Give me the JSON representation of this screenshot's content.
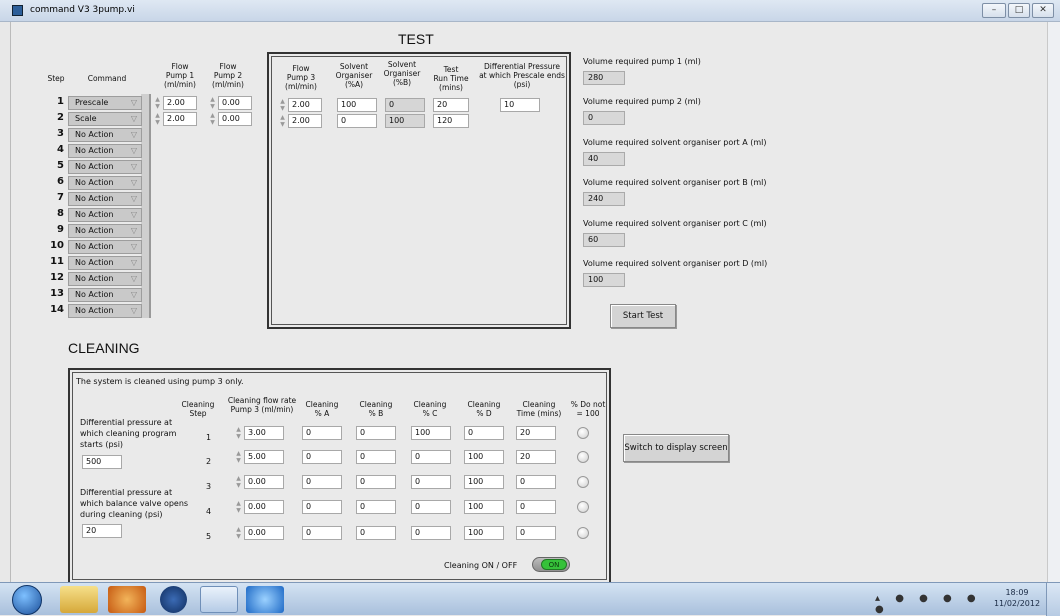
{
  "window": {
    "title": "command V3 3pump.vi",
    "controls": [
      "–",
      "□",
      "✕"
    ]
  },
  "test": {
    "title": "TEST",
    "headers": {
      "step": "Step",
      "command": "Command",
      "flow1": [
        "Flow",
        "Pump 1",
        "(ml/min)"
      ],
      "flow2": [
        "Flow",
        "Pump 2",
        "(ml/min)"
      ],
      "flow3": [
        "Flow",
        "Pump 3",
        "(ml/min)"
      ],
      "solA": [
        "Solvent",
        "Organiser",
        "(%A)"
      ],
      "solB": [
        "Solvent",
        "Organiser",
        "(%B)"
      ],
      "runtime": [
        "Test",
        "Run Time",
        "(mins)"
      ],
      "dp": [
        "Differential Pressure",
        "at which Prescale ends",
        "(psi)"
      ]
    },
    "steps": [
      "1",
      "2",
      "3",
      "4",
      "5",
      "6",
      "7",
      "8",
      "9",
      "10",
      "11",
      "12",
      "13",
      "14"
    ],
    "commands": [
      "Prescale",
      "Scale",
      "No Action",
      "No Action",
      "No Action",
      "No Action",
      "No Action",
      "No Action",
      "No Action",
      "No Action",
      "No Action",
      "No Action",
      "No Action",
      "No Action"
    ],
    "rows": [
      {
        "flow1": "2.00",
        "flow2": "0.00",
        "flow3": "2.00",
        "solA": "100",
        "solB": "0",
        "runtime": "20",
        "dp": "10"
      },
      {
        "flow1": "2.00",
        "flow2": "0.00",
        "flow3": "2.00",
        "solA": "0",
        "solB": "100",
        "runtime": "120"
      }
    ]
  },
  "volumes": [
    {
      "label": "Volume required pump 1 (ml)",
      "value": "280"
    },
    {
      "label": "Volume required pump 2 (ml)",
      "value": "0"
    },
    {
      "label": "Volume required solvent organiser port A (ml)",
      "value": "40"
    },
    {
      "label": "Volume required solvent organiser port B (ml)",
      "value": "240"
    },
    {
      "label": "Volume required solvent organiser port C (ml)",
      "value": "60"
    },
    {
      "label": "Volume required solvent organiser port D (ml)",
      "value": "100"
    }
  ],
  "start_test": "Start Test",
  "switch_display": "Switch to display screen",
  "cleaning": {
    "title": "CLEANING",
    "note": "The system is cleaned using pump 3 only.",
    "dp_start_label": [
      "Differential pressure at",
      "which cleaning program",
      "starts (psi)"
    ],
    "dp_start_value": "500",
    "dp_balance_label": [
      "Differential pressure at",
      "which balance valve opens",
      "during cleaning (psi)"
    ],
    "dp_balance_value": "20",
    "headers": {
      "step": [
        "Cleaning",
        "Step"
      ],
      "flow": [
        "Cleaning flow rate",
        "Pump 3 (ml/min)"
      ],
      "a": [
        "Cleaning",
        "% A"
      ],
      "b": [
        "Cleaning",
        "% B"
      ],
      "c": [
        "Cleaning",
        "% C"
      ],
      "d": [
        "Cleaning",
        "% D"
      ],
      "time": [
        "Cleaning",
        "Time (mins)"
      ],
      "donot": [
        "% Do not",
        "= 100"
      ]
    },
    "rows": [
      {
        "step": "1",
        "flow": "3.00",
        "a": "0",
        "b": "0",
        "c": "100",
        "d": "0",
        "time": "20"
      },
      {
        "step": "2",
        "flow": "5.00",
        "a": "0",
        "b": "0",
        "c": "0",
        "d": "100",
        "time": "20"
      },
      {
        "step": "3",
        "flow": "0.00",
        "a": "0",
        "b": "0",
        "c": "0",
        "d": "100",
        "time": "0"
      },
      {
        "step": "4",
        "flow": "0.00",
        "a": "0",
        "b": "0",
        "c": "0",
        "d": "100",
        "time": "0"
      },
      {
        "step": "5",
        "flow": "0.00",
        "a": "0",
        "b": "0",
        "c": "0",
        "d": "100",
        "time": "0"
      }
    ],
    "onoff_label": "Cleaning ON / OFF",
    "onoff_state": "ON"
  },
  "taskbar": {
    "time": "18:09",
    "date": "11/02/2012"
  }
}
